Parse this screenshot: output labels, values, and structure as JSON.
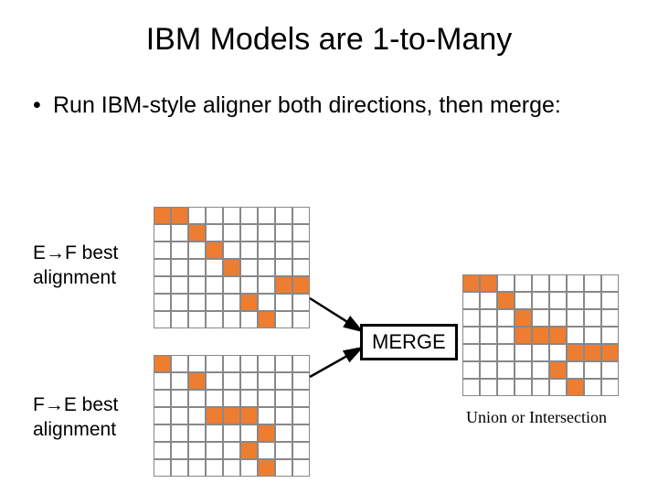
{
  "title": "IBM Models are 1-to-Many",
  "bullet": "Run IBM-style aligner both directions, then merge:",
  "ef_label_1": "E→F best",
  "ef_label_2": "alignment",
  "fe_label_1": "F→E best",
  "fe_label_2": "alignment",
  "merge_label": "MERGE",
  "caption": "Union or Intersection",
  "grids": {
    "ef": {
      "rows": 7,
      "cols": 9,
      "filled": [
        [
          0,
          0
        ],
        [
          0,
          1
        ],
        [
          1,
          2
        ],
        [
          2,
          3
        ],
        [
          3,
          4
        ],
        [
          4,
          7
        ],
        [
          4,
          8
        ],
        [
          5,
          5
        ],
        [
          6,
          6
        ]
      ]
    },
    "fe": {
      "rows": 7,
      "cols": 9,
      "filled": [
        [
          0,
          0
        ],
        [
          1,
          2
        ],
        [
          3,
          3
        ],
        [
          3,
          4
        ],
        [
          3,
          5
        ],
        [
          4,
          6
        ],
        [
          5,
          5
        ],
        [
          6,
          6
        ]
      ]
    },
    "merged": {
      "rows": 7,
      "cols": 9,
      "filled": [
        [
          0,
          0
        ],
        [
          0,
          1
        ],
        [
          1,
          2
        ],
        [
          2,
          3
        ],
        [
          3,
          3
        ],
        [
          3,
          4
        ],
        [
          3,
          5
        ],
        [
          4,
          6
        ],
        [
          4,
          7
        ],
        [
          4,
          8
        ],
        [
          5,
          5
        ],
        [
          6,
          6
        ]
      ]
    }
  }
}
